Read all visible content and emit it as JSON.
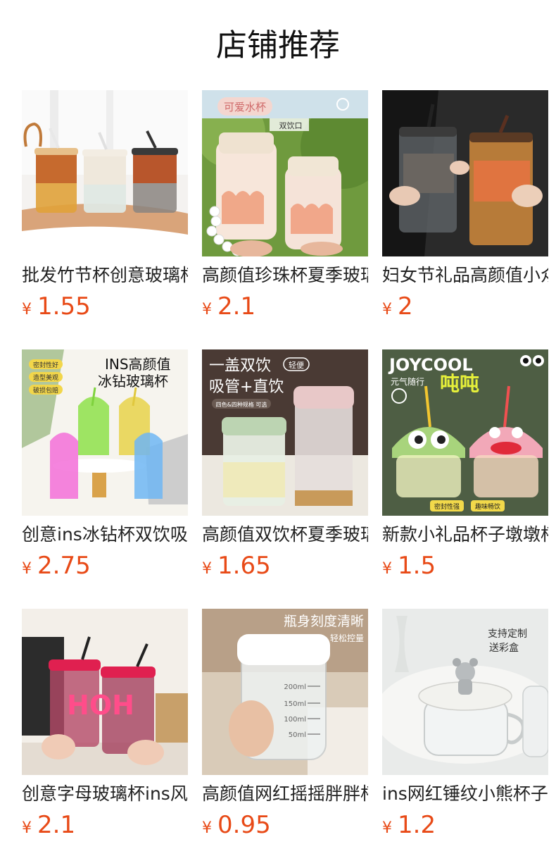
{
  "section": {
    "title": "店铺推荐"
  },
  "products": [
    {
      "name": "批发竹节杯创意玻璃杯",
      "currency": "¥",
      "price": "1.55",
      "image": "three-amber-white-gray-glass-cups-with-straws"
    },
    {
      "name": "高颜值珍珠杯夏季玻璃杯",
      "currency": "¥",
      "price": "2.1",
      "image": "cute-floral-glass-cups-with-pearl-strap",
      "image_text": {
        "badge": "可爱水杯",
        "tag": "双饮口"
      }
    },
    {
      "name": "妇女节礼品高颜值小众杯",
      "currency": "¥",
      "price": "2",
      "image": "hands-holding-gray-and-orange-sleeve-cups"
    },
    {
      "name": "创意ins冰钻杯双饮吸管杯",
      "currency": "¥",
      "price": "2.75",
      "image": "colorful-diamond-textured-cups",
      "image_text": {
        "headline1": "INS高颜值",
        "headline2": "冰钻玻璃杯",
        "tags": [
          "密封性好",
          "造型美观",
          "破损包赔"
        ]
      }
    },
    {
      "name": "高颜值双饮杯夏季玻璃杯",
      "currency": "¥",
      "price": "1.65",
      "image": "green-and-pink-dual-drink-cups",
      "image_text": {
        "headline1": "一盖双饮",
        "tag": "轻便",
        "headline2": "吸管+直饮",
        "sub": "四色&四种规格 可选"
      }
    },
    {
      "name": "新款小礼品杯子墩墩杯",
      "currency": "¥",
      "price": "1.5",
      "image": "cartoon-lid-cups-joycool",
      "image_text": {
        "brand": "JOYCOOL",
        "sub": "元气随行",
        "headline": "吨吨",
        "tags": [
          "密封性强",
          "趣味畅饮"
        ]
      }
    },
    {
      "name": "创意字母玻璃杯ins风杯子",
      "currency": "¥",
      "price": "2.1",
      "image": "pink-letter-glass-cups-with-straws",
      "image_text": {
        "letters": "HOH"
      }
    },
    {
      "name": "高颜值网红摇摇胖胖杯",
      "currency": "¥",
      "price": "0.95",
      "image": "measured-glass-jar-with-white-lid",
      "image_text": {
        "headline1": "瓶身刻度清晰",
        "headline2": "轻松控量",
        "marks": [
          "200ml",
          "150ml",
          "100ml",
          "50ml"
        ]
      }
    },
    {
      "name": "ins网红锤纹小熊杯子带盖",
      "currency": "¥",
      "price": "1.2",
      "image": "hammered-glass-mug-with-bear-lid",
      "image_text": {
        "headline1": "支持定制",
        "headline2": "送彩盒"
      }
    }
  ],
  "colors": {
    "price": "#e84a17",
    "title": "#111111",
    "name": "#222222"
  }
}
